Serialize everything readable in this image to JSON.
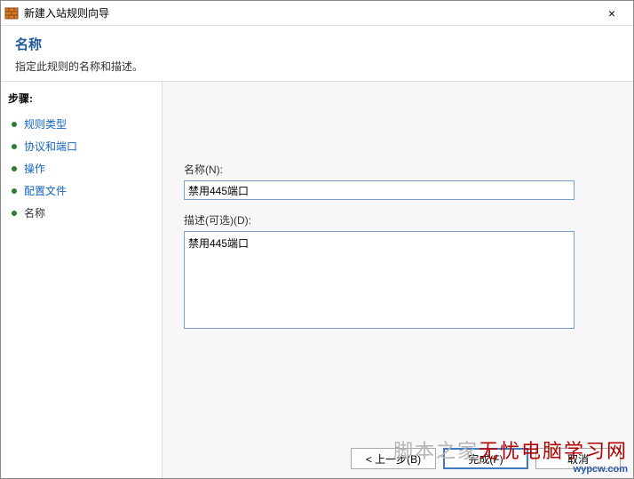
{
  "window": {
    "title": "新建入站规则向导",
    "close_label": "×"
  },
  "header": {
    "heading": "名称",
    "subtitle": "指定此规则的名称和描述。"
  },
  "sidebar": {
    "steps_label": "步骤:",
    "items": [
      {
        "label": "规则类型"
      },
      {
        "label": "协议和端口"
      },
      {
        "label": "操作"
      },
      {
        "label": "配置文件"
      },
      {
        "label": "名称"
      }
    ]
  },
  "form": {
    "name_label": "名称(N):",
    "name_value": "禁用445端口",
    "desc_label": "描述(可选)(D):",
    "desc_value": "禁用445端口"
  },
  "buttons": {
    "back": "< 上一步(B)",
    "finish": "完成(F)",
    "cancel": "取消"
  },
  "watermark": {
    "line1a": "脚本之家",
    "line1b": "无忧电脑学习网",
    "line2": "wypcw.com"
  }
}
